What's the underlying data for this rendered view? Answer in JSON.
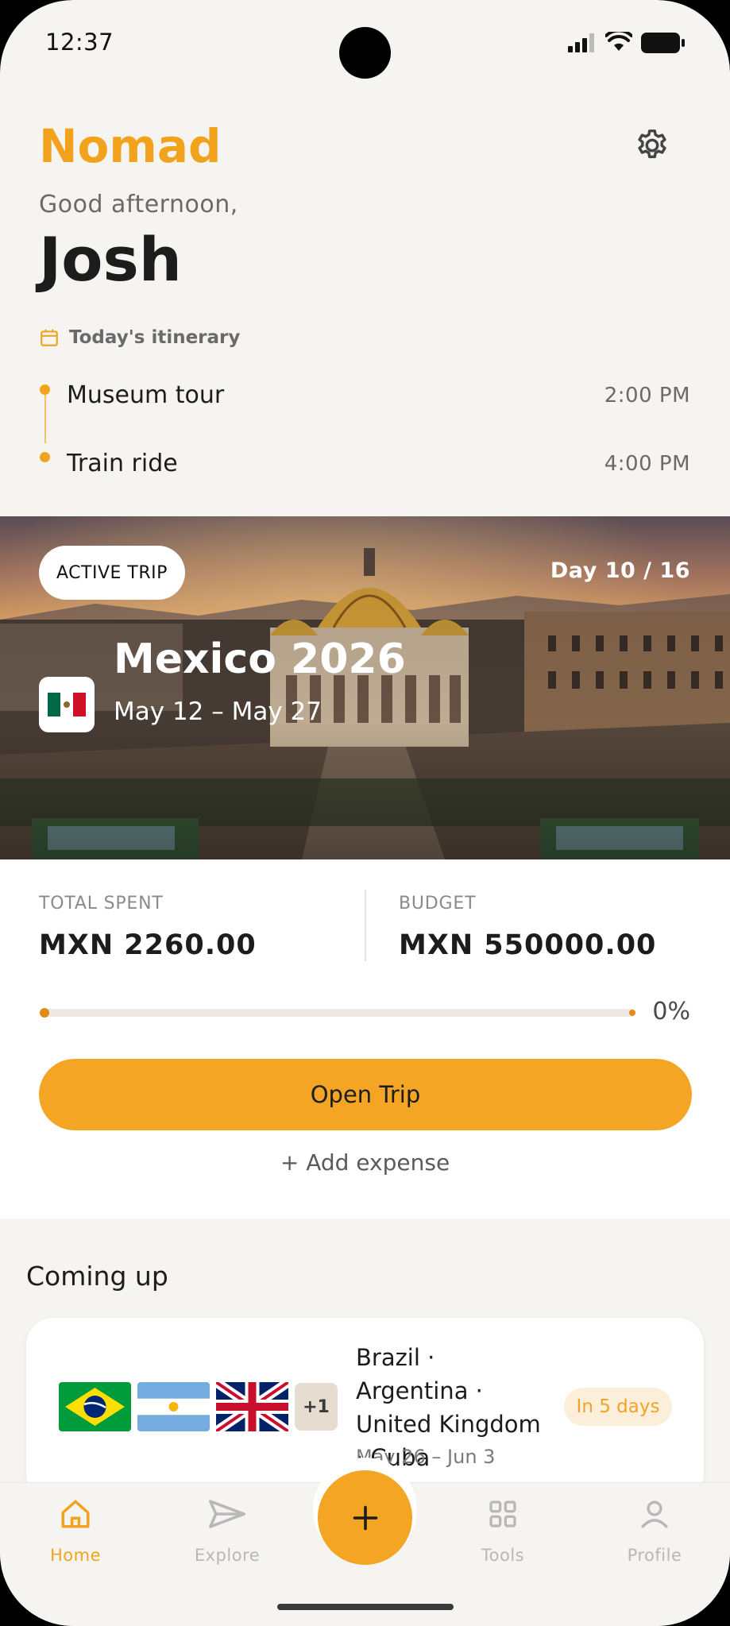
{
  "status_bar": {
    "time": "12:37"
  },
  "header": {
    "brand": "Nomad",
    "greeting": "Good afternoon,",
    "user_name": "Josh",
    "settings_icon": "gear-icon"
  },
  "itinerary": {
    "title": "Today's itinerary",
    "items": [
      {
        "name": "Museum tour",
        "time": "2:00 PM"
      },
      {
        "name": "Train ride",
        "time": "4:00 PM"
      }
    ]
  },
  "active_trip": {
    "badge": "ACTIVE TRIP",
    "day_progress": "Day 10 / 16",
    "title": "Mexico 2026",
    "dates": "May 12 – May 27",
    "flag": "mexico-flag"
  },
  "budget": {
    "spent_label": "TOTAL SPENT",
    "spent_value": "MXN 2260.00",
    "budget_label": "BUDGET",
    "budget_value": "MXN 550000.00",
    "progress_fraction": 0.004,
    "percent_label": "0%",
    "open_button": "Open Trip",
    "add_expense": "+ Add expense"
  },
  "coming_up": {
    "title": "Coming up",
    "trip": {
      "destinations": "Brazil · Argentina · United Kingdom · Cuba",
      "dates": "May 26 – Jun 3",
      "countdown": "In 5 days",
      "extra_flags": "+1",
      "flags": [
        "brazil-flag",
        "argentina-flag",
        "uk-flag"
      ]
    }
  },
  "nav": {
    "items": [
      {
        "label": "Home",
        "icon": "home-icon",
        "active": true
      },
      {
        "label": "Explore",
        "icon": "paper-plane-icon",
        "active": false
      },
      {
        "label": "Tools",
        "icon": "grid-icon",
        "active": false
      },
      {
        "label": "Profile",
        "icon": "user-icon",
        "active": false
      }
    ],
    "fab_icon": "plus-icon"
  },
  "colors": {
    "accent": "#f2a31e",
    "button": "#f3a523",
    "text": "#1c1c1c",
    "muted": "#6a6a6a",
    "background": "#f6f4f1"
  }
}
